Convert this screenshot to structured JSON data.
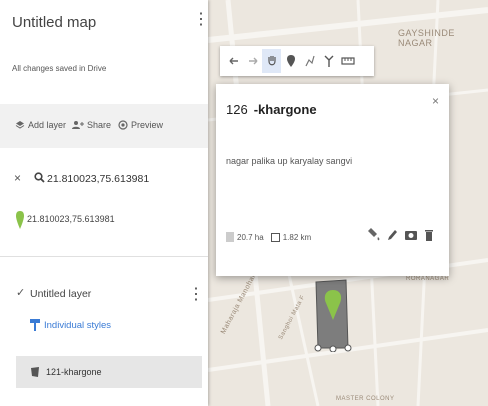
{
  "map": {
    "labels": {
      "top_line1": "GAYSHINDE",
      "top_line2": "NAGAR",
      "road": "Maharaja Manohar Rd",
      "road2": "Sanghoi Mata F",
      "side": "RORANAGAR",
      "bottom": "MASTER COLONY"
    }
  },
  "panel": {
    "title": "Untitled map",
    "saved_status": "All changes saved in Drive",
    "actions": {
      "add_layer": "Add layer",
      "share": "Share",
      "preview": "Preview"
    },
    "search": {
      "close": "×",
      "value": "21.810023,75.613981"
    },
    "result": {
      "text": "21.810023,75.613981"
    },
    "layer": {
      "name": "Untitled layer",
      "styles": "Individual styles",
      "feature": "121-khargone"
    }
  },
  "card": {
    "number": "126",
    "title": "-khargone",
    "description": "nagar palika up karyalay sangvi",
    "area": "20.7 ha",
    "perimeter": "1.82 km",
    "close": "×"
  },
  "colors": {
    "accent_blue": "#3a7bd5",
    "pin_green": "#8bc34a",
    "polygon_fill": "#7d7d7d",
    "map_bg": "#ece7df"
  }
}
